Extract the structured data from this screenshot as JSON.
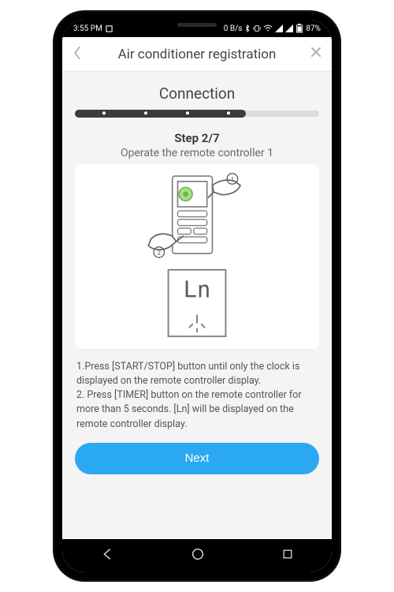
{
  "statusbar": {
    "time": "3:55 PM",
    "data_rate": "0 B/s",
    "battery": "87%"
  },
  "appbar": {
    "title": "Air conditioner registration"
  },
  "section": {
    "title": "Connection"
  },
  "progress": {
    "current": 2,
    "total": 7,
    "fill_percent": 70
  },
  "step": {
    "label": "Step 2/7",
    "subtitle": "Operate the remote controller 1",
    "display_text": "Ln"
  },
  "instructions": {
    "line1": "1.Press [START/STOP] button until only the clock is displayed on the remote controller display.",
    "line2": "2. Press [TIMER] button on the remote controller for more than 5 seconds. [Ln] will be displayed on the remote controller display."
  },
  "buttons": {
    "next": "Next"
  }
}
